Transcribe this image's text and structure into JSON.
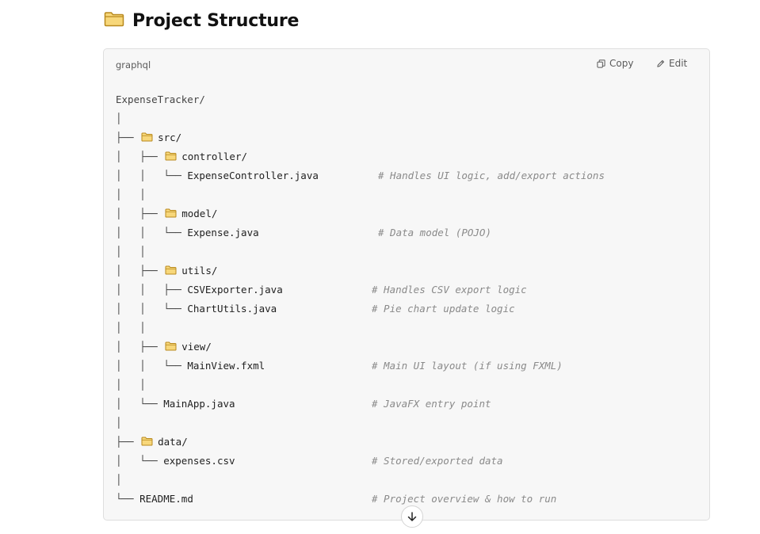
{
  "heading": {
    "title": "Project Structure"
  },
  "code_block": {
    "language": "graphql",
    "copy_label": "Copy",
    "edit_label": "Edit",
    "lines": [
      {
        "tree": "ExpenseTracker/",
        "name": "",
        "folder": false,
        "comment": ""
      },
      {
        "tree": "│",
        "name": "",
        "folder": false,
        "comment": ""
      },
      {
        "tree": "├── ",
        "name": "src/",
        "folder": true,
        "comment": ""
      },
      {
        "tree": "│   ├── ",
        "name": "controller/",
        "folder": true,
        "comment": ""
      },
      {
        "tree": "│   │   └── ",
        "name": "ExpenseController.java",
        "folder": false,
        "comment": "# Handles UI logic, add/export actions",
        "col": 2
      },
      {
        "tree": "│   │",
        "name": "",
        "folder": false,
        "comment": ""
      },
      {
        "tree": "│   ├── ",
        "name": "model/",
        "folder": true,
        "comment": ""
      },
      {
        "tree": "│   │   └── ",
        "name": "Expense.java",
        "folder": false,
        "comment": "# Data model (POJO)",
        "col": 2
      },
      {
        "tree": "│   │",
        "name": "",
        "folder": false,
        "comment": ""
      },
      {
        "tree": "│   ├── ",
        "name": "utils/",
        "folder": true,
        "comment": ""
      },
      {
        "tree": "│   │   ├── ",
        "name": "CSVExporter.java",
        "folder": false,
        "comment": "# Handles CSV export logic",
        "col": 1
      },
      {
        "tree": "│   │   └── ",
        "name": "ChartUtils.java",
        "folder": false,
        "comment": "# Pie chart update logic",
        "col": 1
      },
      {
        "tree": "│   │",
        "name": "",
        "folder": false,
        "comment": ""
      },
      {
        "tree": "│   ├── ",
        "name": "view/",
        "folder": true,
        "comment": ""
      },
      {
        "tree": "│   │   └── ",
        "name": "MainView.fxml",
        "folder": false,
        "comment": "# Main UI layout (if using FXML)",
        "col": 1
      },
      {
        "tree": "│   │",
        "name": "",
        "folder": false,
        "comment": ""
      },
      {
        "tree": "│   └── ",
        "name": "MainApp.java",
        "folder": false,
        "comment": "# JavaFX entry point",
        "col": 1
      },
      {
        "tree": "│",
        "name": "",
        "folder": false,
        "comment": ""
      },
      {
        "tree": "├── ",
        "name": "data/",
        "folder": true,
        "comment": ""
      },
      {
        "tree": "│   └── ",
        "name": "expenses.csv",
        "folder": false,
        "comment": "# Stored/exported data",
        "col": 1
      },
      {
        "tree": "│",
        "name": "",
        "folder": false,
        "comment": ""
      },
      {
        "tree": "└── ",
        "name": "README.md",
        "folder": false,
        "comment": "# Project overview & how to run",
        "col": 1
      }
    ]
  },
  "icons": {
    "heading": "folder-icon",
    "copy": "copy-icon",
    "edit": "edit-icon",
    "scroll": "arrow-down-icon"
  },
  "colors": {
    "folder_fill": "#f7d77a",
    "folder_stroke": "#b8891e",
    "comment": "#8a8a8a",
    "card_bg": "#f7f7f7"
  }
}
